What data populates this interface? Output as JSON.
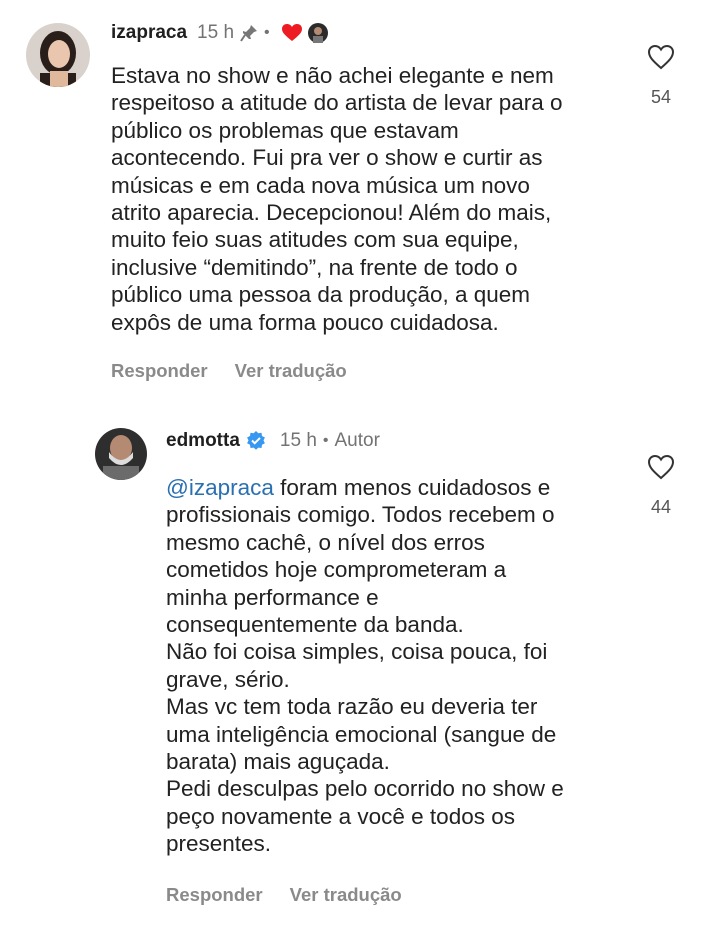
{
  "comments": [
    {
      "username": "izapraca",
      "time": "15 h",
      "text": "Estava no show e não achei elegante e nem\nrespeitoso a atitude do artista de levar para o\npúblico os problemas que estavam\nacontecendo. Fui pra ver o show e curtir as\nmúsicas e em cada nova música um novo\natrito aparecia. Decepcionou! Além do mais,\nmuito feio suas atitudes com sua equipe,\ninclusive “demitindo”, na frente de todo o\npúblico uma pessoa da produção, a quem\nexpôs de uma forma pouco cuidadosa.",
      "likes": "54",
      "reply_label": "Responder",
      "translate_label": "Ver tradução",
      "icons": [
        "pin-icon",
        "red-heart-icon",
        "author-liked-avatar"
      ]
    },
    {
      "username": "edmotta",
      "time": "15 h",
      "author_label": "Autor",
      "mention": "@izapraca",
      "text": " foram menos cuidadosos e\nprofissionais comigo. Todos recebem o\nmesmo cachê, o nível dos erros\ncometidos hoje comprometeram a\nminha performance e\nconsequentemente da banda.\nNão foi coisa simples, coisa pouca, foi\ngrave, sério.\nMas vc tem toda razão eu deveria ter\numa inteligência emocional (sangue de\nbarata) mais aguçada.\nPedi desculpas pelo ocorrido no show e\npeço novamente a você e todos os\npresentes.",
      "likes": "44",
      "reply_label": "Responder",
      "translate_label": "Ver tradução",
      "icons": [
        "verified-badge-icon"
      ]
    }
  ],
  "colors": {
    "mention": "#2a6fb0",
    "verified": "#3897f0",
    "heart_red": "#ed1c24",
    "muted": "#737373"
  }
}
